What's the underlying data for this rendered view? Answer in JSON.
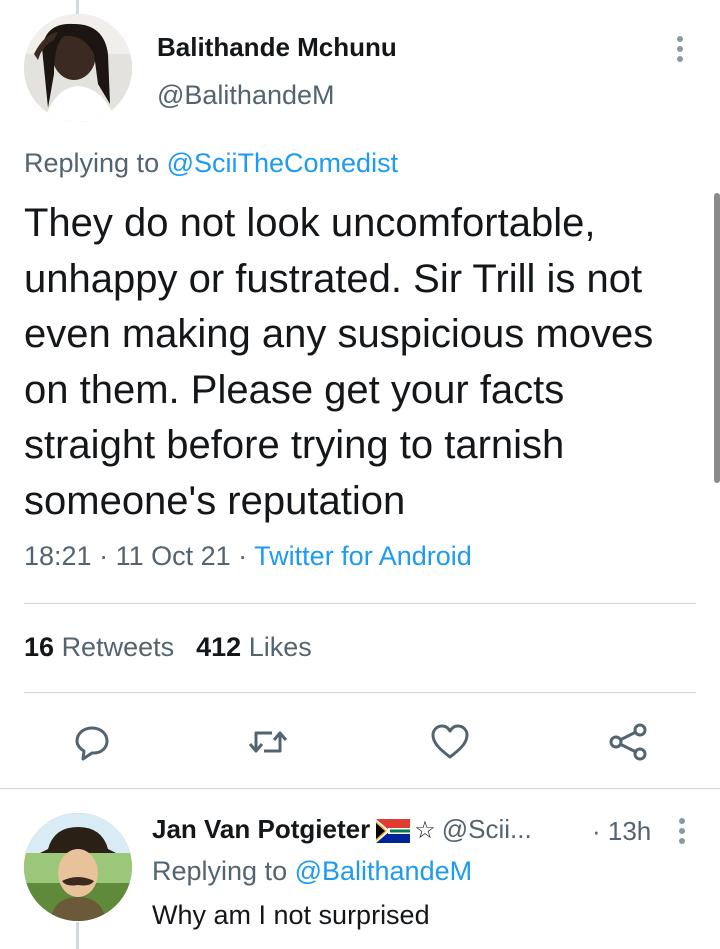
{
  "tweet": {
    "author_name": "Balithande Mchunu",
    "author_handle": "@BalithandeM",
    "replying_prefix": "Replying to ",
    "replying_to": "@SciiTheComedist",
    "body": "They do not look uncomfortable, unhappy or fustrated. Sir Trill is not even making any suspicious moves on them. Please get your facts straight before trying to tarnish someone's reputation",
    "time": "18:21",
    "separator": " · ",
    "date": "11 Oct 21",
    "source": "Twitter for Android",
    "retweets_count": "16",
    "retweets_label": "Retweets",
    "likes_count": "412",
    "likes_label": "Likes"
  },
  "actions": {
    "reply_icon": "reply-icon",
    "retweet_icon": "retweet-icon",
    "like_icon": "heart-icon",
    "share_icon": "share-icon"
  },
  "reply": {
    "author_name": "Jan Van Potgieter",
    "flag_icon": "south-africa-flag-icon",
    "star": "☆",
    "author_handle": "@Scii...",
    "time": "· 13h",
    "replying_prefix": "Replying to ",
    "replying_to": "@BalithandeM",
    "body": "Why am I not surprised"
  },
  "colors": {
    "link": "#1d9bf0",
    "secondary_text": "#536471",
    "primary_text": "#14171a",
    "divider": "#cfd9de"
  }
}
